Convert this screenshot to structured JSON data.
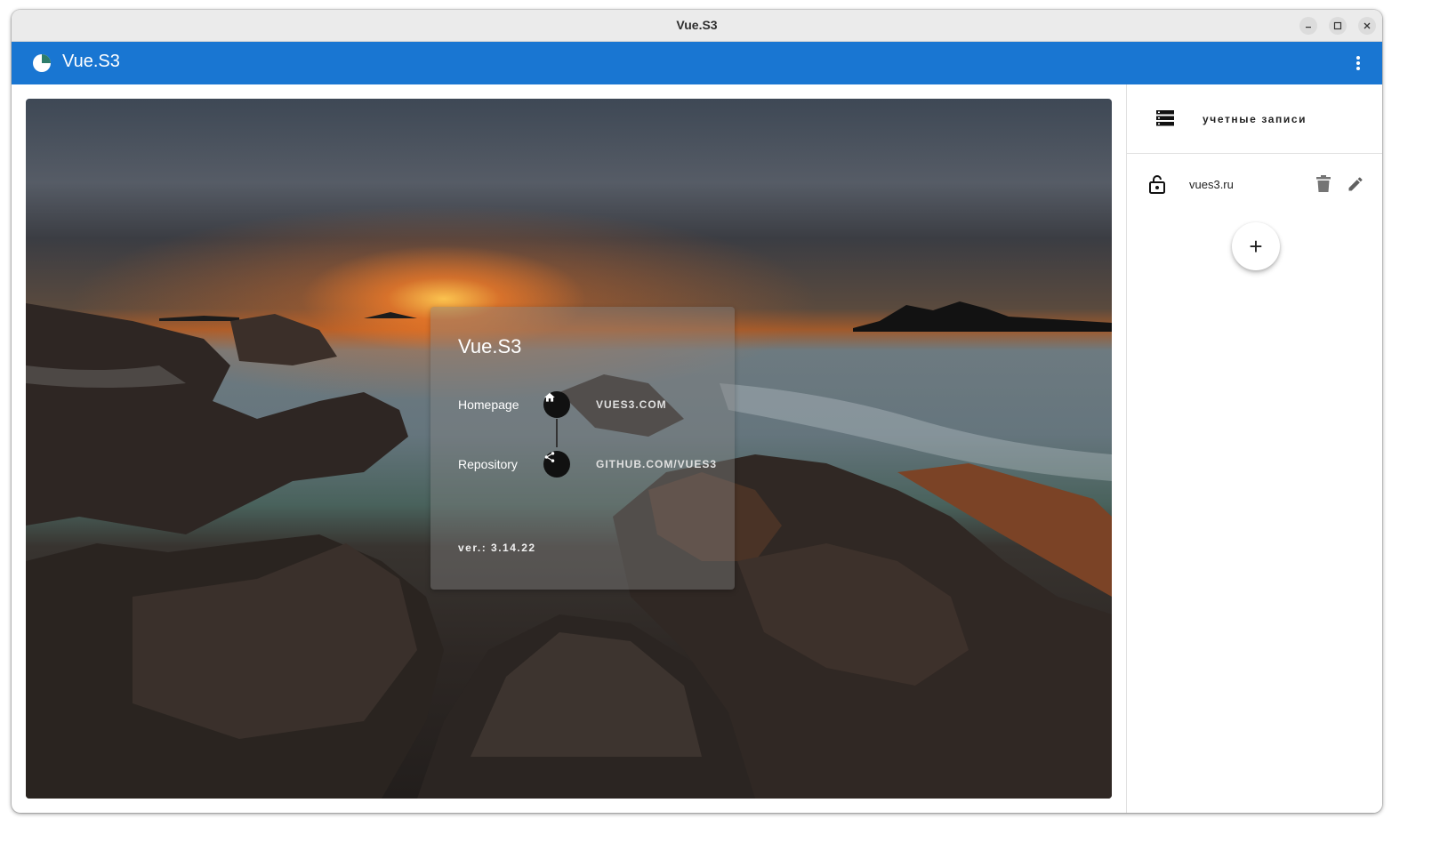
{
  "window": {
    "title": "Vue.S3"
  },
  "appbar": {
    "title": "Vue.S3",
    "color": "#1976d2"
  },
  "about_card": {
    "title": "Vue.S3",
    "homepage_label": "Homepage",
    "homepage_link": "VUES3.COM",
    "repository_label": "Repository",
    "repository_link": "GITHUB.COM/VUES3",
    "version": "ver.: 3.14.22"
  },
  "sidebar": {
    "header_label": "учетные записи",
    "accounts": [
      {
        "name": "vues3.ru"
      }
    ],
    "add_button_label": "+"
  },
  "icons": [
    "app-logo-icon",
    "more-vert-icon",
    "home-icon",
    "share-icon",
    "storage-icon",
    "lock-open-icon",
    "delete-icon",
    "edit-icon",
    "minimize-icon",
    "maximize-icon",
    "close-icon"
  ]
}
